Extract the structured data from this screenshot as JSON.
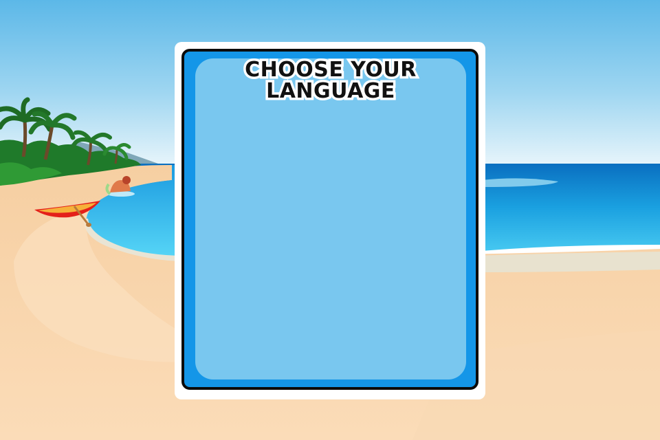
{
  "dialog": {
    "title_line1": "CHOOSE YOUR",
    "title_line2": "LANGUAGE",
    "options": []
  },
  "background": {
    "scene": "tropical-beach",
    "colors": {
      "sky_top": "#5cb8e8",
      "sky_bottom": "#eaf6fb",
      "sea_dark": "#0a6fc0",
      "sea_light": "#3fc4f0",
      "sand": "#f7d3a8",
      "panel_frame": "#1496e8",
      "panel_inner": "#79c7ef"
    }
  }
}
